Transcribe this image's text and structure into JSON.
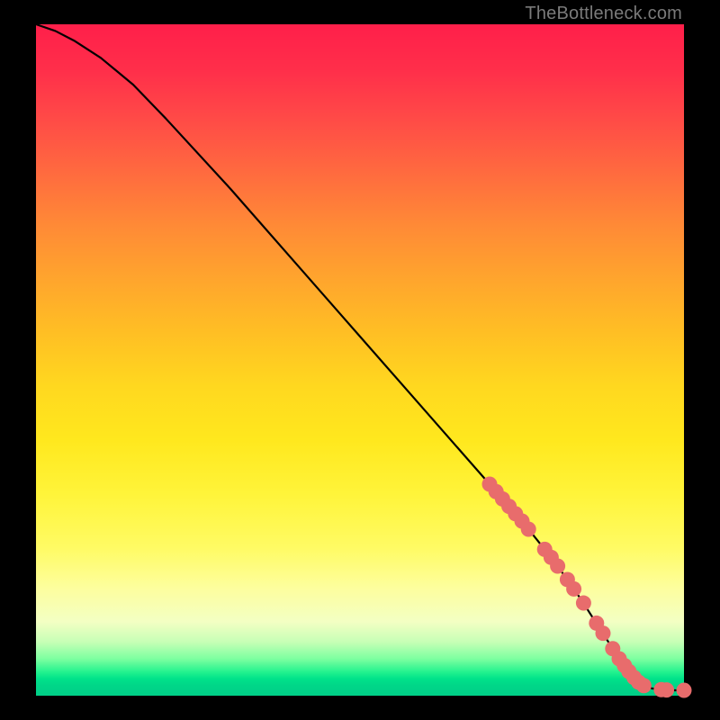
{
  "watermark": "TheBottleneck.com",
  "chart_data": {
    "type": "line",
    "title": "",
    "xlabel": "",
    "ylabel": "",
    "xlim": [
      0,
      100
    ],
    "ylim": [
      0,
      100
    ],
    "curve": {
      "name": "bottleneck-curve",
      "x": [
        0,
        3,
        6,
        10,
        15,
        20,
        30,
        40,
        50,
        60,
        70,
        75,
        80,
        84,
        86,
        88,
        90,
        92,
        94,
        96,
        98,
        100
      ],
      "y": [
        100,
        99,
        97.5,
        95,
        91,
        86,
        75.5,
        64.5,
        53.5,
        42.5,
        31.5,
        26,
        20,
        14.5,
        11.5,
        8.5,
        5.5,
        3,
        1.3,
        0.9,
        0.8,
        0.8
      ]
    },
    "markers": {
      "name": "highlighted-points",
      "color": "#e86c6c",
      "points": [
        {
          "x": 70.0,
          "y": 31.5
        },
        {
          "x": 71.0,
          "y": 30.4
        },
        {
          "x": 72.0,
          "y": 29.3
        },
        {
          "x": 73.0,
          "y": 28.2
        },
        {
          "x": 74.0,
          "y": 27.1
        },
        {
          "x": 75.0,
          "y": 26.0
        },
        {
          "x": 76.0,
          "y": 24.8
        },
        {
          "x": 78.5,
          "y": 21.8
        },
        {
          "x": 79.5,
          "y": 20.6
        },
        {
          "x": 80.5,
          "y": 19.3
        },
        {
          "x": 82.0,
          "y": 17.3
        },
        {
          "x": 83.0,
          "y": 15.9
        },
        {
          "x": 84.5,
          "y": 13.8
        },
        {
          "x": 86.5,
          "y": 10.8
        },
        {
          "x": 87.5,
          "y": 9.3
        },
        {
          "x": 89.0,
          "y": 7.0
        },
        {
          "x": 90.0,
          "y": 5.5
        },
        {
          "x": 90.8,
          "y": 4.5
        },
        {
          "x": 91.5,
          "y": 3.6
        },
        {
          "x": 92.3,
          "y": 2.7
        },
        {
          "x": 93.0,
          "y": 2.0
        },
        {
          "x": 93.8,
          "y": 1.5
        },
        {
          "x": 96.5,
          "y": 0.9
        },
        {
          "x": 97.3,
          "y": 0.85
        },
        {
          "x": 100.0,
          "y": 0.8
        }
      ]
    }
  }
}
